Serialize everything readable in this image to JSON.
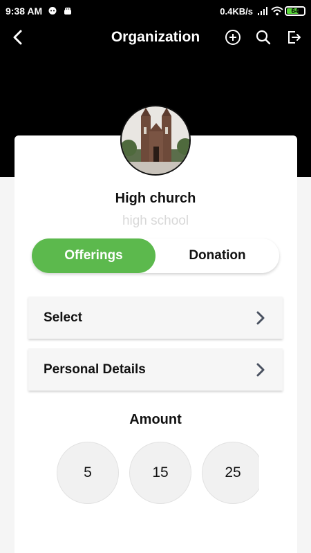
{
  "status_bar": {
    "time": "9:38 AM",
    "network_speed": "0.4KB/s",
    "battery": "64",
    "icons": [
      "chat-bubble-icon",
      "android-icon",
      "signal-icon",
      "wifi-icon",
      "battery-icon"
    ]
  },
  "app_bar": {
    "title": "Organization",
    "icons": [
      "back-arrow-icon",
      "add-circle-icon",
      "search-icon",
      "logout-icon"
    ]
  },
  "organization": {
    "name": "High church",
    "subtitle": "high school"
  },
  "tabs": {
    "items": [
      {
        "label": "Offerings",
        "active": true
      },
      {
        "label": "Donation",
        "active": false
      }
    ]
  },
  "rows": [
    {
      "label": "Select"
    },
    {
      "label": "Personal Details"
    }
  ],
  "amount": {
    "label": "Amount",
    "options": [
      "5",
      "15",
      "25"
    ]
  },
  "colors": {
    "accent": "#5cb94d",
    "header_bg": "#000000",
    "subtitle": "#d8d8d8"
  }
}
